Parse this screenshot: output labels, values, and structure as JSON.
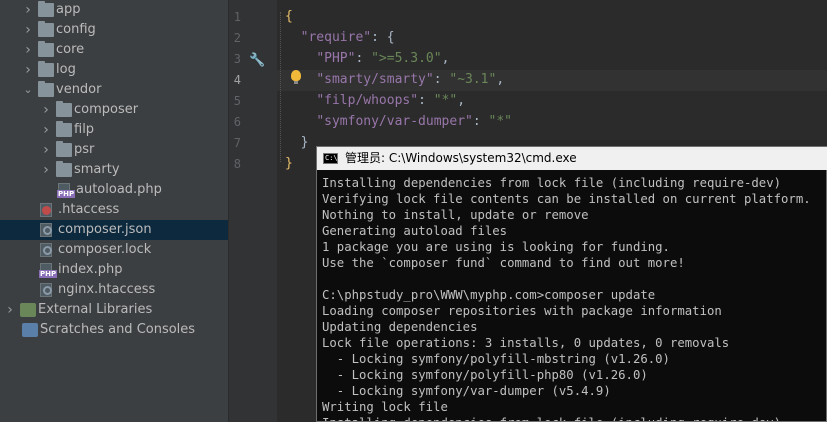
{
  "project_tree": {
    "items": [
      {
        "label": "app",
        "kind": "folder",
        "expanded": false,
        "depth": 1
      },
      {
        "label": "config",
        "kind": "folder",
        "expanded": false,
        "depth": 1
      },
      {
        "label": "core",
        "kind": "folder",
        "expanded": false,
        "depth": 1
      },
      {
        "label": "log",
        "kind": "folder",
        "expanded": false,
        "depth": 1
      },
      {
        "label": "vendor",
        "kind": "folder",
        "expanded": true,
        "depth": 1
      },
      {
        "label": "composer",
        "kind": "folder",
        "expanded": false,
        "depth": 2
      },
      {
        "label": "filp",
        "kind": "folder",
        "expanded": false,
        "depth": 2
      },
      {
        "label": "psr",
        "kind": "folder",
        "expanded": false,
        "depth": 2
      },
      {
        "label": "smarty",
        "kind": "folder",
        "expanded": false,
        "depth": 2
      },
      {
        "label": "autoload.php",
        "kind": "php",
        "depth": 2
      },
      {
        "label": ".htaccess",
        "kind": "config",
        "depth": 1
      },
      {
        "label": "composer.json",
        "kind": "json",
        "depth": 1,
        "selected": true
      },
      {
        "label": "composer.lock",
        "kind": "json",
        "depth": 1
      },
      {
        "label": "index.php",
        "kind": "php",
        "depth": 1
      },
      {
        "label": "nginx.htaccess",
        "kind": "file",
        "depth": 1
      },
      {
        "label": "External Libraries",
        "kind": "library",
        "expanded": false,
        "depth": 0
      },
      {
        "label": "Scratches and Consoles",
        "kind": "scratch",
        "depth": 0
      }
    ]
  },
  "editor": {
    "line_numbers": [
      "1",
      "2",
      "3",
      "4",
      "5",
      "6",
      "7",
      "8"
    ],
    "current_line": 4,
    "lines": {
      "l1_open": "{",
      "l2_key": "\"require\"",
      "l2_rest": ": {",
      "l3_key": "\"PHP\"",
      "l3_val": "\">=5.3.0\"",
      "l4_key": "\"smarty/smarty\"",
      "l4_val": "\"~3.1\"",
      "l5_key": "\"filp/whoops\"",
      "l5_val": "\"*\"",
      "l6_key": "\"symfony/var-dumper\"",
      "l6_val": "\"*\"",
      "l7_close": "}",
      "l8_close": "}"
    }
  },
  "cmd_window": {
    "title": "管理员: C:\\Windows\\system32\\cmd.exe",
    "icon_text": "C:\\",
    "lines": [
      "Installing dependencies from lock file (including require-dev)",
      "Verifying lock file contents can be installed on current platform.",
      "Nothing to install, update or remove",
      "Generating autoload files",
      "1 package you are using is looking for funding.",
      "Use the `composer fund` command to find out more!",
      "",
      "C:\\phpstudy_pro\\WWW\\myphp.com>composer update",
      "Loading composer repositories with package information",
      "Updating dependencies",
      "Lock file operations: 3 installs, 0 updates, 0 removals",
      "  - Locking symfony/polyfill-mbstring (v1.26.0)",
      "  - Locking symfony/polyfill-php80 (v1.26.0)",
      "  - Locking symfony/var-dumper (v5.4.9)",
      "Writing lock file",
      "Installing dependencies from lock file (including require-dev)"
    ]
  },
  "colors": {
    "tree_bg": "#3c3f41",
    "editor_bg": "#2b2b2b",
    "json_key": "#9876aa",
    "json_string": "#6a8759",
    "selection": "#0d293e",
    "console_bg": "#0c0c0c",
    "console_text": "#c0c0c0"
  }
}
